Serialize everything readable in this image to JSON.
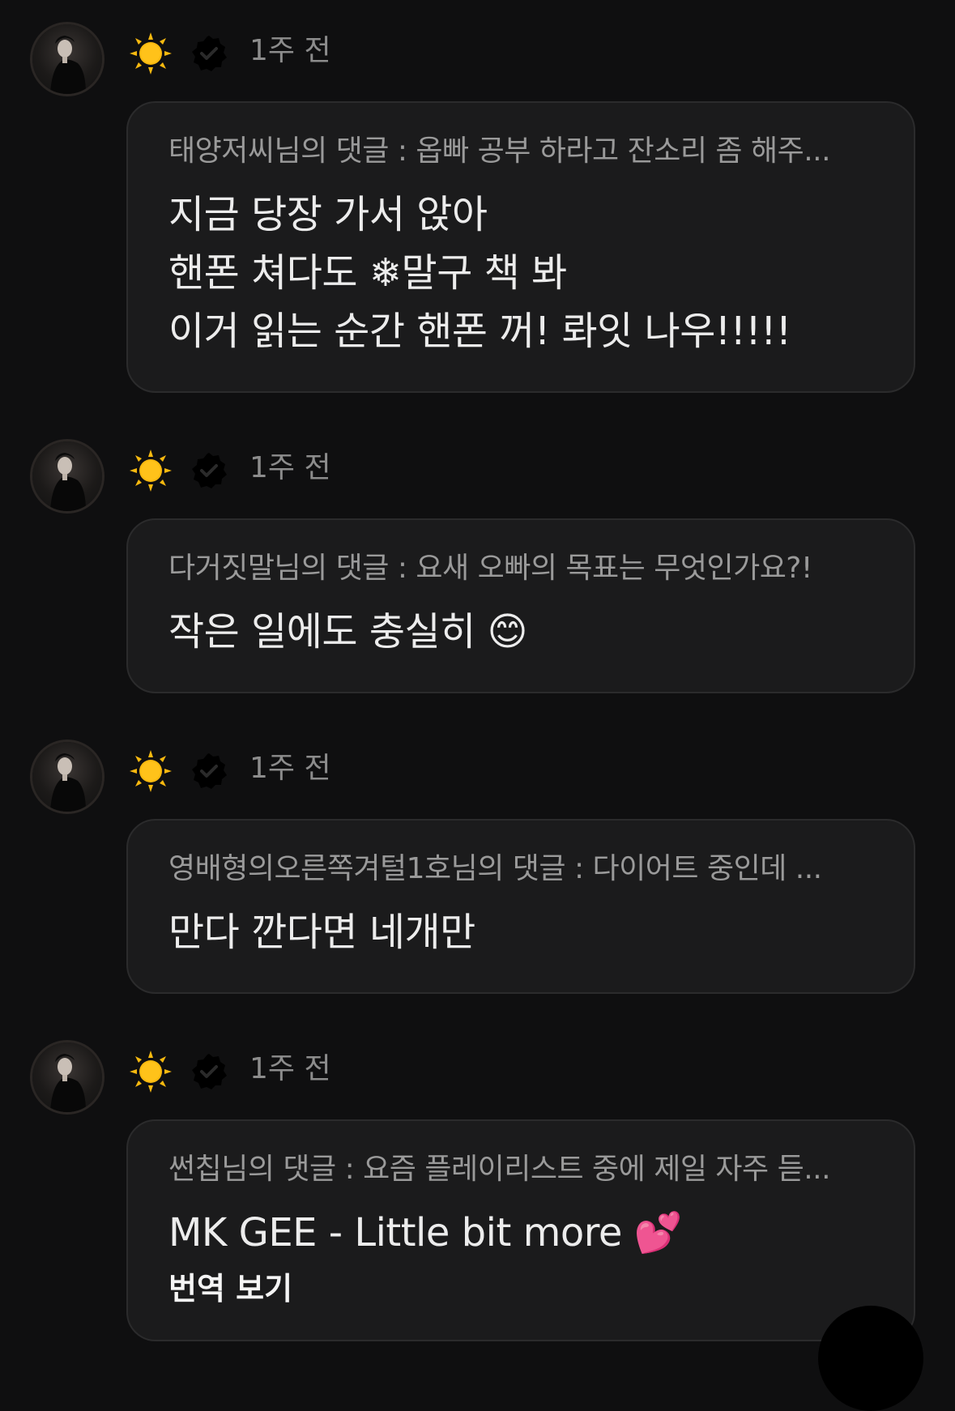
{
  "comments": [
    {
      "timestamp": "1주 전",
      "reply_ref": "태양저씨님의 댓글 : 옵빠 공부 하라고 잔소리 좀 해주...",
      "body": "지금 당장 가서 앉아\n핸폰 쳐다도 ❄말구 책 봐\n이거 읽는 순간 핸폰 꺼! 롸잇 나우!!!!!"
    },
    {
      "timestamp": "1주 전",
      "reply_ref": "다거짓말님의 댓글 : 요새 오빠의 목표는 무엇인가요?!",
      "body": "작은 일에도 충실히 😊"
    },
    {
      "timestamp": "1주 전",
      "reply_ref": "영배형의오른쪽겨털1호님의 댓글 : 다이어트 중인데 ...",
      "body": "만다 깐다면 네개만"
    },
    {
      "timestamp": "1주 전",
      "reply_ref": "썬칩님의 댓글 : 요즘 플레이리스트 중에 제일 자주 듣...",
      "body": "MK GEE - Little bit more 💕",
      "translate_label": "번역 보기"
    }
  ],
  "icons": {
    "author_badge": "sun-icon",
    "verified": "verified-badge-icon"
  },
  "colors": {
    "background": "#0f0f10",
    "bubble": "#1b1b1c",
    "sun": "#f9b90f",
    "muted_text": "#8c8c8c"
  }
}
